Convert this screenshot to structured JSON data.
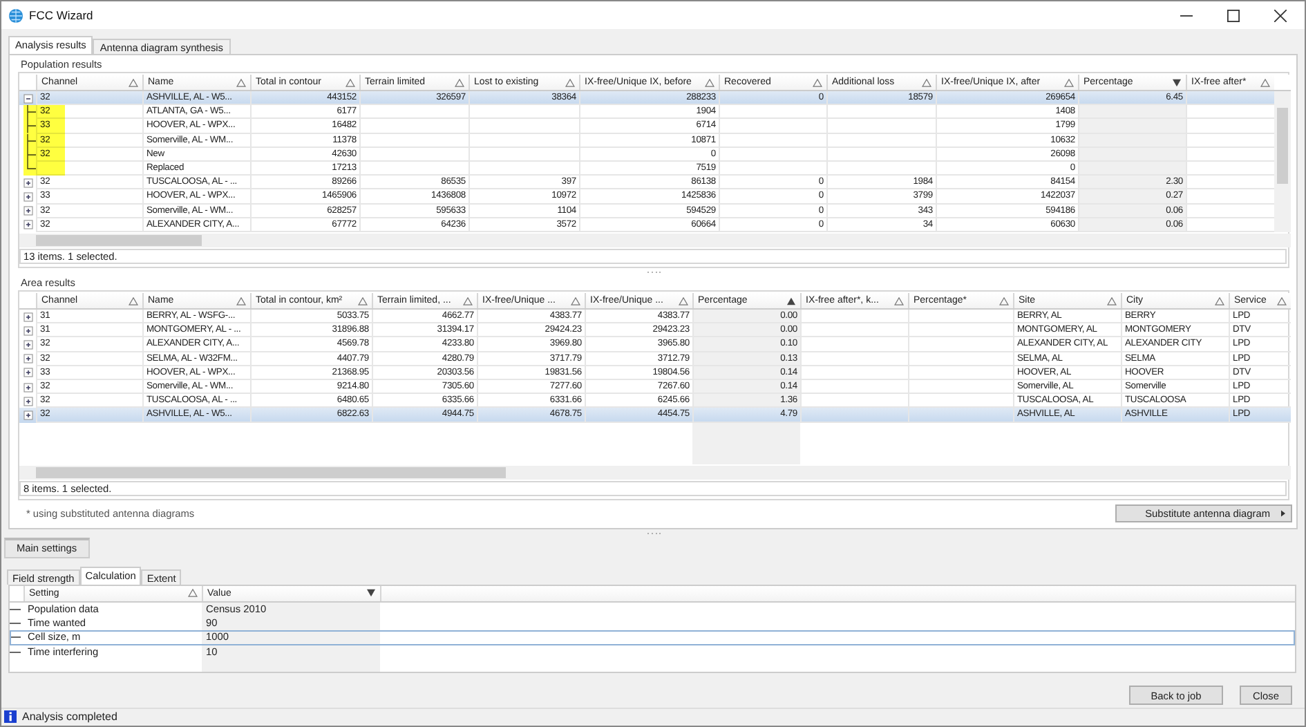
{
  "window": {
    "title": "FCC Wizard"
  },
  "tabs": [
    {
      "label": "Analysis results",
      "selected": true
    },
    {
      "label": "Antenna diagram synthesis",
      "selected": false
    }
  ],
  "population": {
    "title": "Population results",
    "columns": [
      {
        "label": "Channel",
        "kind": "text",
        "sorted": false
      },
      {
        "label": "Name",
        "kind": "text",
        "sorted": false
      },
      {
        "label": "Total in contour",
        "kind": "number",
        "sorted": false
      },
      {
        "label": "Terrain limited",
        "kind": "number",
        "sorted": false
      },
      {
        "label": "Lost to existing",
        "kind": "number",
        "sorted": false
      },
      {
        "label": "IX-free/Unique IX, before",
        "kind": "number",
        "sorted": false
      },
      {
        "label": "Recovered",
        "kind": "number",
        "sorted": false
      },
      {
        "label": "Additional loss",
        "kind": "number",
        "sorted": false
      },
      {
        "label": "IX-free/Unique IX, after",
        "kind": "number",
        "sorted": false
      },
      {
        "label": "Percentage",
        "kind": "number",
        "sorted": true,
        "descending": true
      },
      {
        "label": "IX-free after*",
        "kind": "number",
        "sorted": false
      }
    ],
    "rows": [
      {
        "cells": [
          "32",
          "ASHVILLE, AL - W5...",
          "443152",
          "326597",
          "38364",
          "288233",
          "0",
          "18579",
          "269654",
          "6.45",
          null
        ],
        "selected": true,
        "expanded": true,
        "children": [
          {
            "cells": [
              "32",
              "ATLANTA, GA - W5...",
              "6177",
              null,
              null,
              "1904",
              null,
              null,
              "1408",
              null,
              null
            ],
            "highlighted": true
          },
          {
            "cells": [
              "33",
              "HOOVER, AL - WPX...",
              "16482",
              null,
              null,
              "6714",
              null,
              null,
              "1799",
              null,
              null
            ],
            "highlighted": true
          },
          {
            "cells": [
              "32",
              "Somerville, AL - WM...",
              "11378",
              null,
              null,
              "10871",
              null,
              null,
              "10632",
              null,
              null
            ],
            "highlighted": true
          },
          {
            "cells": [
              "32",
              "New",
              "42630",
              null,
              null,
              "0",
              null,
              null,
              "26098",
              null,
              null
            ],
            "highlighted": true
          },
          {
            "cells": [
              null,
              "Replaced",
              "17213",
              null,
              null,
              "7519",
              null,
              null,
              "0",
              null,
              null
            ],
            "highlighted": true
          }
        ]
      },
      {
        "cells": [
          "32",
          "TUSCALOOSA, AL - ...",
          "89266",
          "86535",
          "397",
          "86138",
          "0",
          "1984",
          "84154",
          "2.30",
          null
        ],
        "selected": false,
        "expanded": false
      },
      {
        "cells": [
          "33",
          "HOOVER, AL - WPX...",
          "1465906",
          "1436808",
          "10972",
          "1425836",
          "0",
          "3799",
          "1422037",
          "0.27",
          null
        ],
        "selected": false,
        "expanded": false
      },
      {
        "cells": [
          "32",
          "Somerville, AL - WM...",
          "628257",
          "595633",
          "1104",
          "594529",
          "0",
          "343",
          "594186",
          "0.06",
          null
        ],
        "selected": false,
        "expanded": false
      },
      {
        "cells": [
          "32",
          "ALEXANDER CITY, A...",
          "67772",
          "64236",
          "3572",
          "60664",
          "0",
          "34",
          "60630",
          "0.06",
          null
        ],
        "selected": false,
        "expanded": false
      }
    ],
    "status": "13 items. 1 selected."
  },
  "area": {
    "title": "Area results",
    "columns": [
      {
        "label": "Channel",
        "kind": "text",
        "sorted": false
      },
      {
        "label": "Name",
        "kind": "text",
        "sorted": false
      },
      {
        "label": "Total in contour, km²",
        "kind": "number",
        "sorted": false
      },
      {
        "label": "Terrain limited, ...",
        "kind": "number",
        "sorted": false
      },
      {
        "label": "IX-free/Unique ...",
        "kind": "number",
        "sorted": false
      },
      {
        "label": "IX-free/Unique ...",
        "kind": "number",
        "sorted": false
      },
      {
        "label": "Percentage",
        "kind": "number",
        "sorted": true,
        "descending": false
      },
      {
        "label": "IX-free after*, k...",
        "kind": "number",
        "sorted": false
      },
      {
        "label": "Percentage*",
        "kind": "number",
        "sorted": false
      },
      {
        "label": "Site",
        "kind": "text",
        "sorted": false
      },
      {
        "label": "City",
        "kind": "text",
        "sorted": false
      },
      {
        "label": "Service",
        "kind": "text",
        "sorted": false
      }
    ],
    "rows": [
      {
        "cells": [
          "31",
          "BERRY, AL - WSFG-...",
          "5033.75",
          "4662.77",
          "4383.77",
          "4383.77",
          "0.00",
          null,
          null,
          "BERRY, AL",
          "BERRY",
          "LPD"
        ],
        "selected": false,
        "expanded": false
      },
      {
        "cells": [
          "31",
          "MONTGOMERY, AL - ...",
          "31896.88",
          "31394.17",
          "29424.23",
          "29423.23",
          "0.00",
          null,
          null,
          "MONTGOMERY, AL",
          "MONTGOMERY",
          "DTV"
        ],
        "selected": false,
        "expanded": false
      },
      {
        "cells": [
          "32",
          "ALEXANDER CITY, A...",
          "4569.78",
          "4233.80",
          "3969.80",
          "3965.80",
          "0.10",
          null,
          null,
          "ALEXANDER CITY, AL",
          "ALEXANDER CITY",
          "LPD"
        ],
        "selected": false,
        "expanded": false
      },
      {
        "cells": [
          "32",
          "SELMA, AL - W32FM...",
          "4407.79",
          "4280.79",
          "3717.79",
          "3712.79",
          "0.13",
          null,
          null,
          "SELMA, AL",
          "SELMA",
          "LPD"
        ],
        "selected": false,
        "expanded": false
      },
      {
        "cells": [
          "33",
          "HOOVER, AL - WPX...",
          "21368.95",
          "20303.56",
          "19831.56",
          "19804.56",
          "0.14",
          null,
          null,
          "HOOVER, AL",
          "HOOVER",
          "DTV"
        ],
        "selected": false,
        "expanded": false
      },
      {
        "cells": [
          "32",
          "Somerville, AL - WM...",
          "9214.80",
          "7305.60",
          "7277.60",
          "7267.60",
          "0.14",
          null,
          null,
          "Somerville, AL",
          "Somerville",
          "LPD"
        ],
        "selected": false,
        "expanded": false
      },
      {
        "cells": [
          "32",
          "TUSCALOOSA, AL - ...",
          "6480.65",
          "6335.66",
          "6331.66",
          "6245.66",
          "1.36",
          null,
          null,
          "TUSCALOOSA, AL",
          "TUSCALOOSA",
          "LPD"
        ],
        "selected": false,
        "expanded": false
      },
      {
        "cells": [
          "32",
          "ASHVILLE, AL - W5...",
          "6822.63",
          "4944.75",
          "4678.75",
          "4454.75",
          "4.79",
          null,
          null,
          "ASHVILLE, AL",
          "ASHVILLE",
          "LPD"
        ],
        "selected": true,
        "expanded": false
      }
    ],
    "status": "8 items. 1 selected.",
    "footnote": "* using substituted antenna diagrams",
    "substitute_button": "Substitute antenna diagram"
  },
  "settings_tabs": [
    {
      "label": "Main settings",
      "selected": true
    }
  ],
  "settings_subtabs": [
    {
      "label": "Field strength",
      "selected": false
    },
    {
      "label": "Calculation",
      "selected": true
    },
    {
      "label": "Extent",
      "selected": false
    }
  ],
  "settings": {
    "columns": [
      {
        "label": "Setting",
        "sorted": false
      },
      {
        "label": "Value",
        "sorted": true,
        "descending": true
      }
    ],
    "rows": [
      {
        "setting": "Population data",
        "value": "Census 2010",
        "focused": false
      },
      {
        "setting": "Time wanted",
        "value": "90",
        "focused": false
      },
      {
        "setting": "Cell size, m",
        "value": "1000",
        "focused": true
      },
      {
        "setting": "Time interfering",
        "value": "10",
        "focused": false
      }
    ]
  },
  "buttons": [
    "Back to job",
    "Close"
  ],
  "status_bar": "Analysis completed"
}
